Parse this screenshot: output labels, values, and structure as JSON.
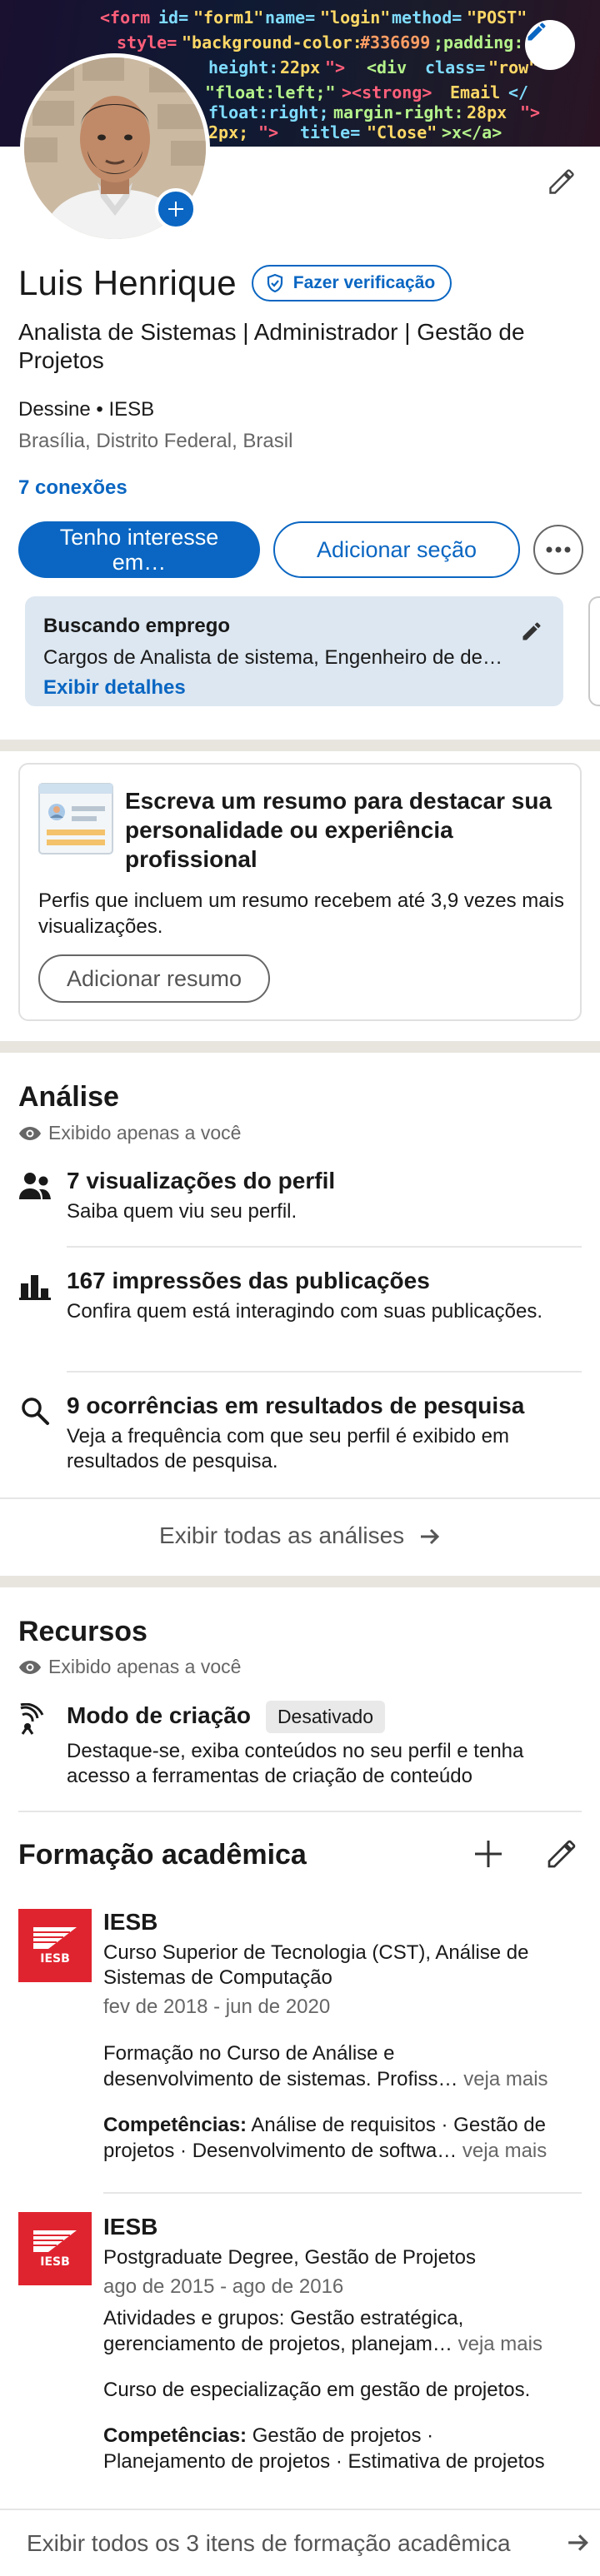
{
  "profile": {
    "name": "Luis Henrique",
    "verify_label": "Fazer verificação",
    "headline": "Analista de Sistemas | Administrador | Gestão de Projetos",
    "company": "Dessine • IESB",
    "location": "Brasília, Distrito Federal, Brasil",
    "connections": "7 conexões"
  },
  "actions": {
    "primary": "Tenho interesse em…",
    "secondary": "Adicionar seção"
  },
  "open_to_work": {
    "title": "Buscando emprego",
    "description": "Cargos de Analista de sistema, Engenheiro de desenvolvimento",
    "link": "Exibir detalhes"
  },
  "about_prompt": {
    "title": "Escreva um resumo para destacar sua personalidade ou experiência profissional",
    "description": "Perfis que incluem um resumo recebem até 3,9 vezes mais visualizações.",
    "button": "Adicionar resumo"
  },
  "analytics": {
    "title": "Análise",
    "private_note": "Exibido apenas a você",
    "items": [
      {
        "icon": "people-icon",
        "title": "7 visualizações do perfil",
        "description": "Saiba quem viu seu perfil."
      },
      {
        "icon": "bar-chart-icon",
        "title": "167 impressões das publicações",
        "description": "Confira quem está interagindo com suas publicações."
      },
      {
        "icon": "search-icon",
        "title": "9 ocorrências em resultados de pesquisa",
        "description": "Veja a frequência com que seu perfil é exibido em resultados de pesquisa."
      }
    ],
    "show_all": "Exibir todas as análises"
  },
  "resources": {
    "title": "Recursos",
    "private_note": "Exibido apenas a você",
    "creator_mode": {
      "title": "Modo de criação",
      "badge": "Desativado",
      "description": "Destaque-se, exiba conteúdos no seu perfil e tenha acesso a ferramentas de criação de conteúdo"
    }
  },
  "education": {
    "title": "Formação acadêmica",
    "items": [
      {
        "logo_text": "IESB",
        "school": "IESB",
        "degree": "Curso Superior de Tecnologia (CST), Análise de Sistemas de Computação",
        "dates": "fev de 2018 - jun de 2020",
        "description_1": "Formação no Curso de Análise e",
        "description_2": "desenvolvimento de sistemas. Profiss…",
        "see_more": "veja mais",
        "skills_label": "Competências:",
        "skills_1": "Análise de requisitos · Gestão de",
        "skills_2": "projetos · Desenvolvimento de softwa…",
        "skills_more": "veja mais"
      },
      {
        "logo_text": "IESB",
        "school": "IESB",
        "degree": "Postgraduate Degree, Gestão de Projetos",
        "dates": "ago de 2015 - ago de 2016",
        "activities_1": "Atividades e grupos: Gestão estratégica,",
        "activities_2": "gerenciamento de projetos, planejam…",
        "see_more": "veja mais",
        "description": "Curso de especialização em gestão de projetos.",
        "skills_label": "Competências:",
        "skills_1": "Gestão de projetos ·",
        "skills_2": "Planejamento de projetos · Estimativa de projetos"
      }
    ],
    "show_all": "Exibir todos os 3 itens de formação acadêmica"
  },
  "colors": {
    "brand_blue": "#0a66c2",
    "iesb_red": "#e0242f",
    "separator": "#e8e5df",
    "open_to_work_bg": "#dde7f1"
  }
}
